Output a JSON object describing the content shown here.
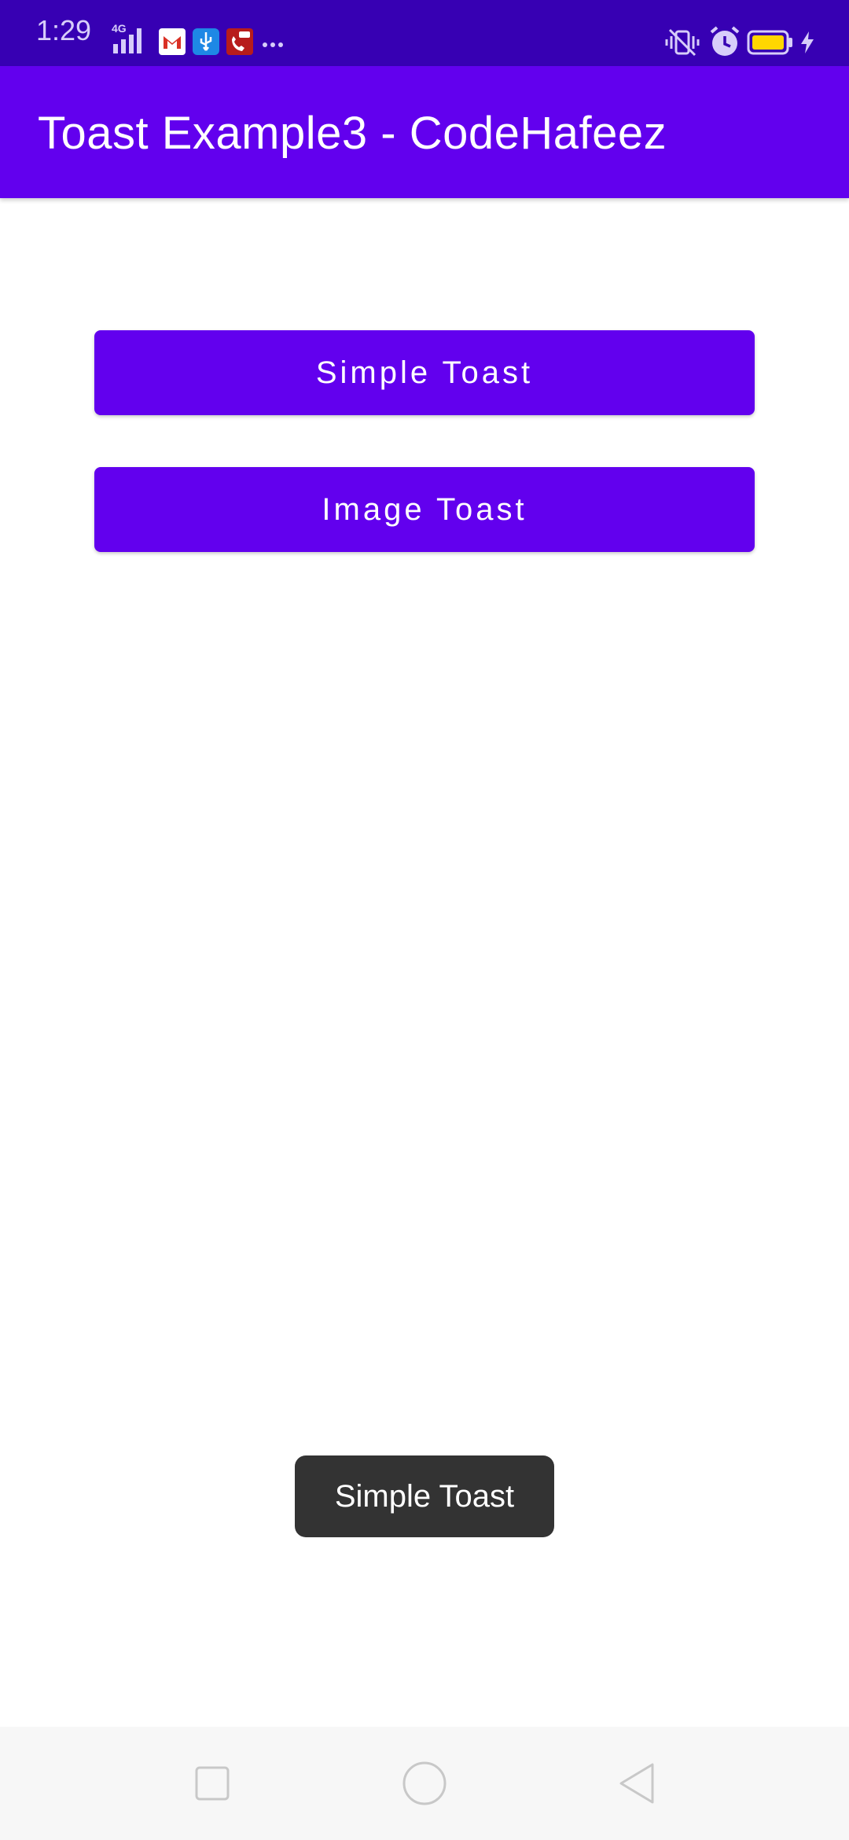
{
  "status_bar": {
    "time": "1:29",
    "network": "4G",
    "icons": [
      "signal-icon",
      "gmail-icon",
      "usb-icon",
      "call-recorder-icon",
      "more-notifications-icon",
      "vibrate-icon",
      "alarm-icon",
      "battery-icon",
      "charging-icon"
    ],
    "battery_color": "#ffd600"
  },
  "app_bar": {
    "title": "Toast Example3 - CodeHafeez",
    "color": "#6200ee"
  },
  "buttons": {
    "simple_toast": "Simple Toast",
    "image_toast": "Image Toast"
  },
  "toast": {
    "message": "Simple Toast"
  },
  "nav_bar": {
    "icons": [
      "recents-icon",
      "home-icon",
      "back-icon"
    ]
  },
  "colors": {
    "status_bar": "#3700b3",
    "primary": "#6200ee",
    "toast_bg": "#333333"
  }
}
